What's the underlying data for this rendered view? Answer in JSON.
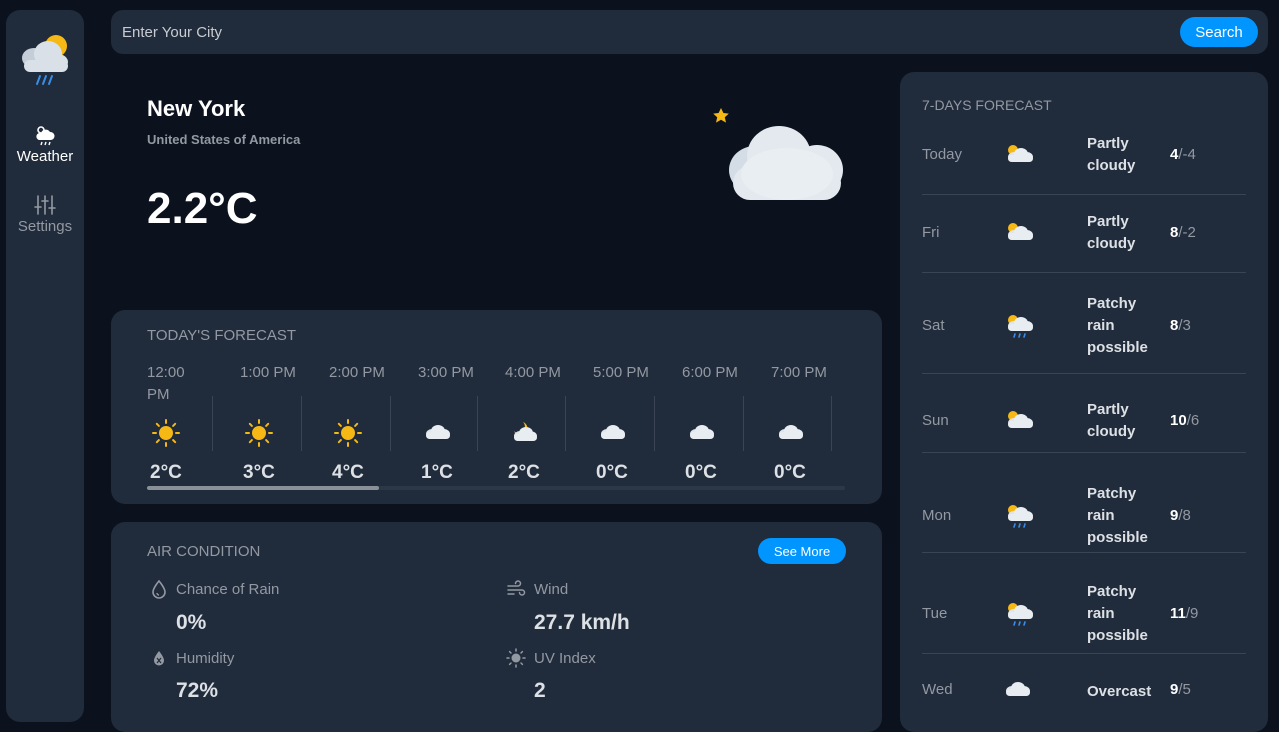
{
  "sidebar": {
    "logo_icon": "cloud-sun-rain-icon",
    "items": [
      {
        "label": "Weather",
        "icon": "cloud-rain-icon",
        "active": true
      },
      {
        "label": "Settings",
        "icon": "sliders-icon",
        "active": false
      }
    ]
  },
  "search": {
    "placeholder": "Enter Your City",
    "button_label": "Search"
  },
  "current": {
    "city": "New York",
    "country": "United States of America",
    "temperature": "2.2°C",
    "icon": "moon-cloud-icon"
  },
  "today": {
    "title": "TODAY'S FORECAST",
    "hours": [
      {
        "time": "12:00 PM",
        "icon": "sun",
        "temp": "2°C"
      },
      {
        "time": "1:00 PM",
        "icon": "sun",
        "temp": "3°C"
      },
      {
        "time": "2:00 PM",
        "icon": "sun",
        "temp": "4°C"
      },
      {
        "time": "3:00 PM",
        "icon": "cloud",
        "temp": "1°C"
      },
      {
        "time": "4:00 PM",
        "icon": "moon-cloud",
        "temp": "2°C"
      },
      {
        "time": "5:00 PM",
        "icon": "cloud",
        "temp": "0°C"
      },
      {
        "time": "6:00 PM",
        "icon": "cloud",
        "temp": "0°C"
      },
      {
        "time": "7:00 PM",
        "icon": "cloud",
        "temp": "0°C"
      }
    ]
  },
  "air": {
    "title": "AIR CONDITION",
    "see_more_label": "See More",
    "metrics": [
      {
        "label": "Chance of Rain",
        "value": "0%",
        "icon": "droplet-icon"
      },
      {
        "label": "Wind",
        "value": "27.7 km/h",
        "icon": "wind-icon"
      },
      {
        "label": "Humidity",
        "value": "72%",
        "icon": "humidity-icon"
      },
      {
        "label": "UV Index",
        "value": "2",
        "icon": "sun-icon"
      }
    ]
  },
  "week": {
    "title": "7-DAYS FORECAST",
    "days": [
      {
        "day": "Today",
        "icon": "sun-cloud",
        "condition": "Partly cloudy",
        "high": "4",
        "low": "-4"
      },
      {
        "day": "Fri",
        "icon": "sun-cloud",
        "condition": "Partly cloudy",
        "high": "8",
        "low": "-2"
      },
      {
        "day": "Sat",
        "icon": "sun-cloud-rain",
        "condition": "Patchy rain possible",
        "high": "8",
        "low": "3"
      },
      {
        "day": "Sun",
        "icon": "sun-cloud",
        "condition": "Partly cloudy",
        "high": "10",
        "low": "6"
      },
      {
        "day": "Mon",
        "icon": "sun-cloud-rain",
        "condition": "Patchy rain possible",
        "high": "9",
        "low": "8"
      },
      {
        "day": "Tue",
        "icon": "sun-cloud-rain",
        "condition": "Patchy rain possible",
        "high": "11",
        "low": "9"
      },
      {
        "day": "Wed",
        "icon": "cloud",
        "condition": "Overcast",
        "high": "9",
        "low": "5"
      }
    ]
  },
  "colors": {
    "background": "#0b121e",
    "panel": "#202b3b",
    "accent": "#0095ff",
    "muted_text": "#9399a2",
    "sun": "#f5b815"
  }
}
